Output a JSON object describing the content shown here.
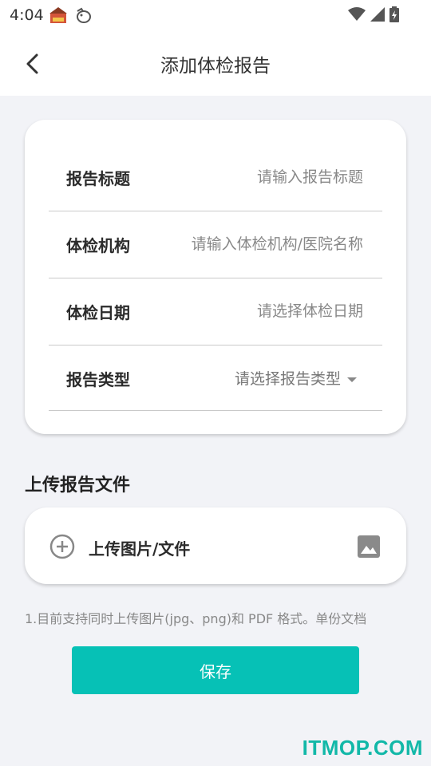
{
  "status_bar": {
    "time": "4:04",
    "icons": [
      "app-notification-icon",
      "bird-notification-icon",
      "wifi-icon",
      "signal-icon",
      "battery-charging-icon"
    ]
  },
  "header": {
    "title": "添加体检报告",
    "back_icon": "chevron-left-icon"
  },
  "form": {
    "fields": [
      {
        "label": "报告标题",
        "placeholder": "请输入报告标题"
      },
      {
        "label": "体检机构",
        "placeholder": "请输入体检机构/医院名称"
      },
      {
        "label": "体检日期",
        "placeholder": "请选择体检日期"
      },
      {
        "label": "报告类型",
        "placeholder": "请选择报告类型"
      }
    ]
  },
  "upload": {
    "section_title": "上传报告文件",
    "button_label": "上传图片/文件",
    "note": "1.目前支持同时上传图片(jpg、png)和 PDF 格式。单份文档"
  },
  "actions": {
    "save_label": "保存"
  },
  "watermark": "ITMOP.COM",
  "colors": {
    "accent": "#06c1b6",
    "background": "#f2f3f7",
    "watermark": "#12b8a8"
  }
}
